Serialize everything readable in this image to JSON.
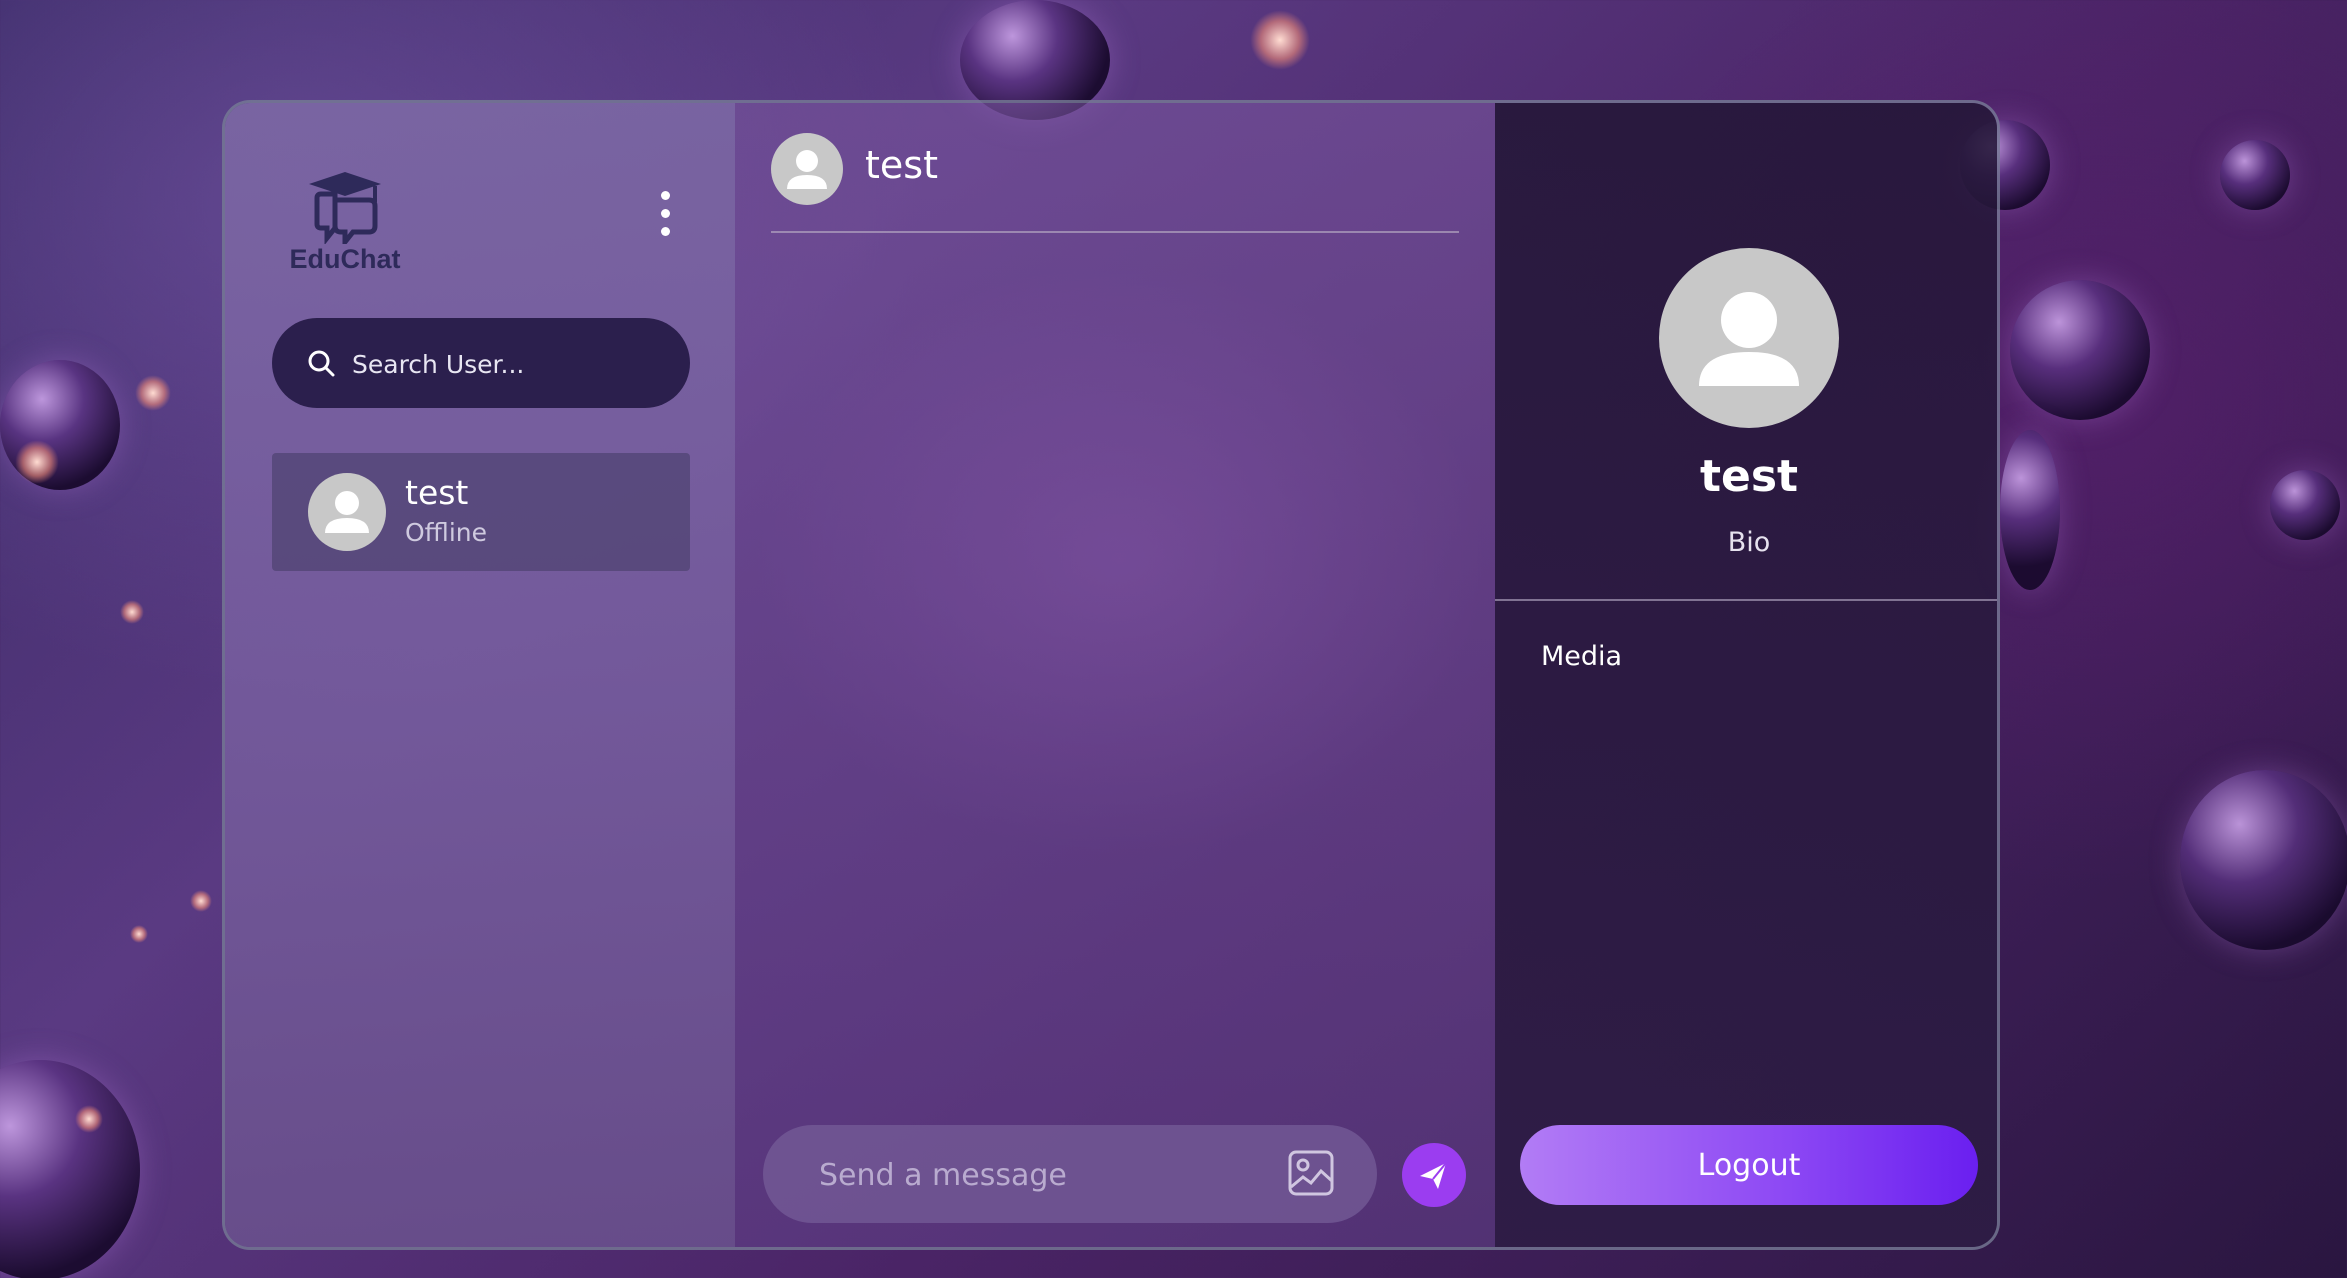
{
  "brand": {
    "name": "EduChat"
  },
  "sidebar": {
    "search": {
      "placeholder": "Search User..."
    },
    "users": [
      {
        "name": "test",
        "status": "Offline"
      }
    ]
  },
  "chat": {
    "header_name": "test",
    "composer": {
      "placeholder": "Send a message"
    }
  },
  "profile": {
    "name": "test",
    "bio": "Bio",
    "media_label": "Media",
    "logout_label": "Logout"
  },
  "colors": {
    "accent": "#9b3df0",
    "logout_gradient_start": "#b27cf5",
    "logout_gradient_end": "#6a1ff0",
    "search_bg": "#2b1f4d",
    "logo": "#2e2a5a"
  }
}
